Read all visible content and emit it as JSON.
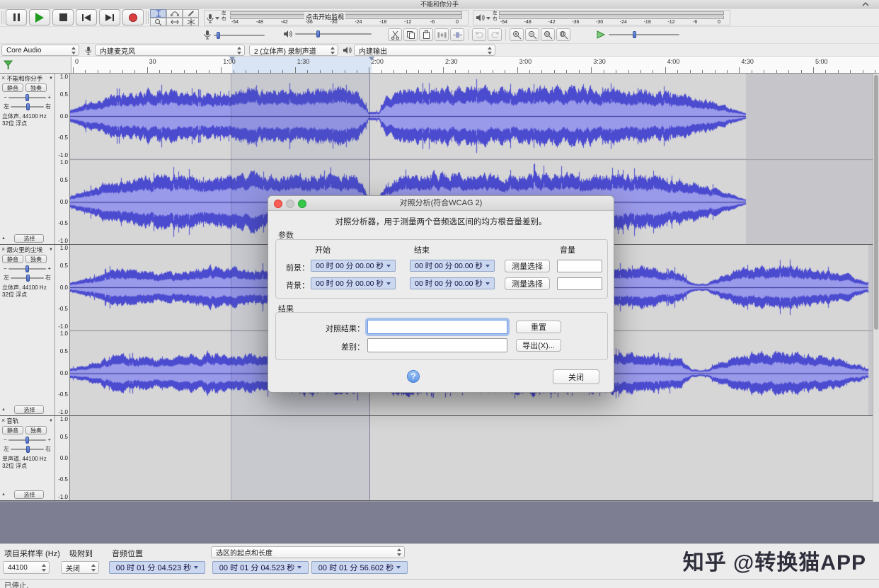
{
  "window": {
    "title": "不能和你分手"
  },
  "meters": {
    "left": "左",
    "right": "右",
    "monitor_text": "点击开始监视",
    "scale": [
      "-54",
      "-48",
      "-42",
      "-36",
      "-30",
      "-24",
      "-18",
      "-12",
      "-6",
      "0"
    ]
  },
  "device": {
    "host": "Core Audio",
    "input": "内建麦克风",
    "channels": "2 (立体声) 录制声道",
    "output": "内建输出"
  },
  "timeline": {
    "ticks": [
      "0",
      "30",
      "1:00",
      "1:30",
      "2:00",
      "2:30",
      "3:00",
      "3:30",
      "4:00",
      "4:30",
      "5:00"
    ]
  },
  "track_ui": {
    "close": "×",
    "dropdown": "▼",
    "mute": "静音",
    "solo": "独奏",
    "minus": "−",
    "plus": "+",
    "left": "左",
    "right": "右",
    "collapse": "▲",
    "select": "选择"
  },
  "tracks": [
    {
      "name": "不能和你分手",
      "format1": "立体声, 44100 Hz",
      "format2": "32位 浮点",
      "scale": [
        "1.0",
        "0.5",
        "0.0",
        "-0.5",
        "-1.0"
      ]
    },
    {
      "name": "烟火里的尘埃",
      "format1": "立体声, 44100 Hz",
      "format2": "32位 浮点",
      "scale": [
        "1.0",
        "0.5",
        "0.0",
        "-0.5",
        "-1.0"
      ]
    },
    {
      "name": "音轨",
      "format1": "单声道, 44100 Hz",
      "format2": "32位 浮点",
      "scale": [
        "1.0",
        "0.5",
        "0.0",
        "-0.5",
        "-1.0"
      ]
    }
  ],
  "dialog": {
    "title": "对照分析(符合WCAG 2)",
    "description": "对照分析器，用于测量两个音频选区间的均方根音量差别。",
    "params_group": "参数",
    "col_start": "开始",
    "col_end": "结束",
    "col_volume": "音量",
    "fg_label": "前景：",
    "bg_label": "背景：",
    "fg_start": "00 时 00 分 00.00 秒",
    "fg_end": "00 时 00 分 00.00 秒",
    "bg_start": "00 时 00 分 00.00 秒",
    "bg_end": "00 时 00 分 00.00 秒",
    "measure_fg": "测量选择",
    "measure_bg": "测量选择",
    "fg_volume": "",
    "bg_volume": "",
    "results_group": "结果",
    "contrast_label": "对照结果：",
    "contrast_value": "",
    "reset_btn": "重置",
    "diff_label": "差别：",
    "diff_value": "",
    "export_btn": "导出(X)...",
    "help": "?",
    "close_btn": "关闭"
  },
  "bottom": {
    "rate_label": "项目采样率 (Hz)",
    "rate_value": "44100",
    "snap_label": "吸附到",
    "snap_value": "关闭",
    "position_label": "音频位置",
    "position_value": "00 时 01 分 04.523 秒",
    "selection_label": "选区的起点和长度",
    "sel_start_value": "00 时 01 分 04.523 秒",
    "sel_length_value": "00 时 01 分 56.602 秒",
    "status": "已停止."
  },
  "watermark": "知乎 @转换猫APP",
  "colors": {
    "wave_peak": "#4b4bd0",
    "wave_rms": "#9a9aea",
    "clip_bg": "#d6d6d6",
    "selection_band": "#d9e4f4",
    "record_red": "#d84040",
    "play_green": "#1f9c1f"
  }
}
